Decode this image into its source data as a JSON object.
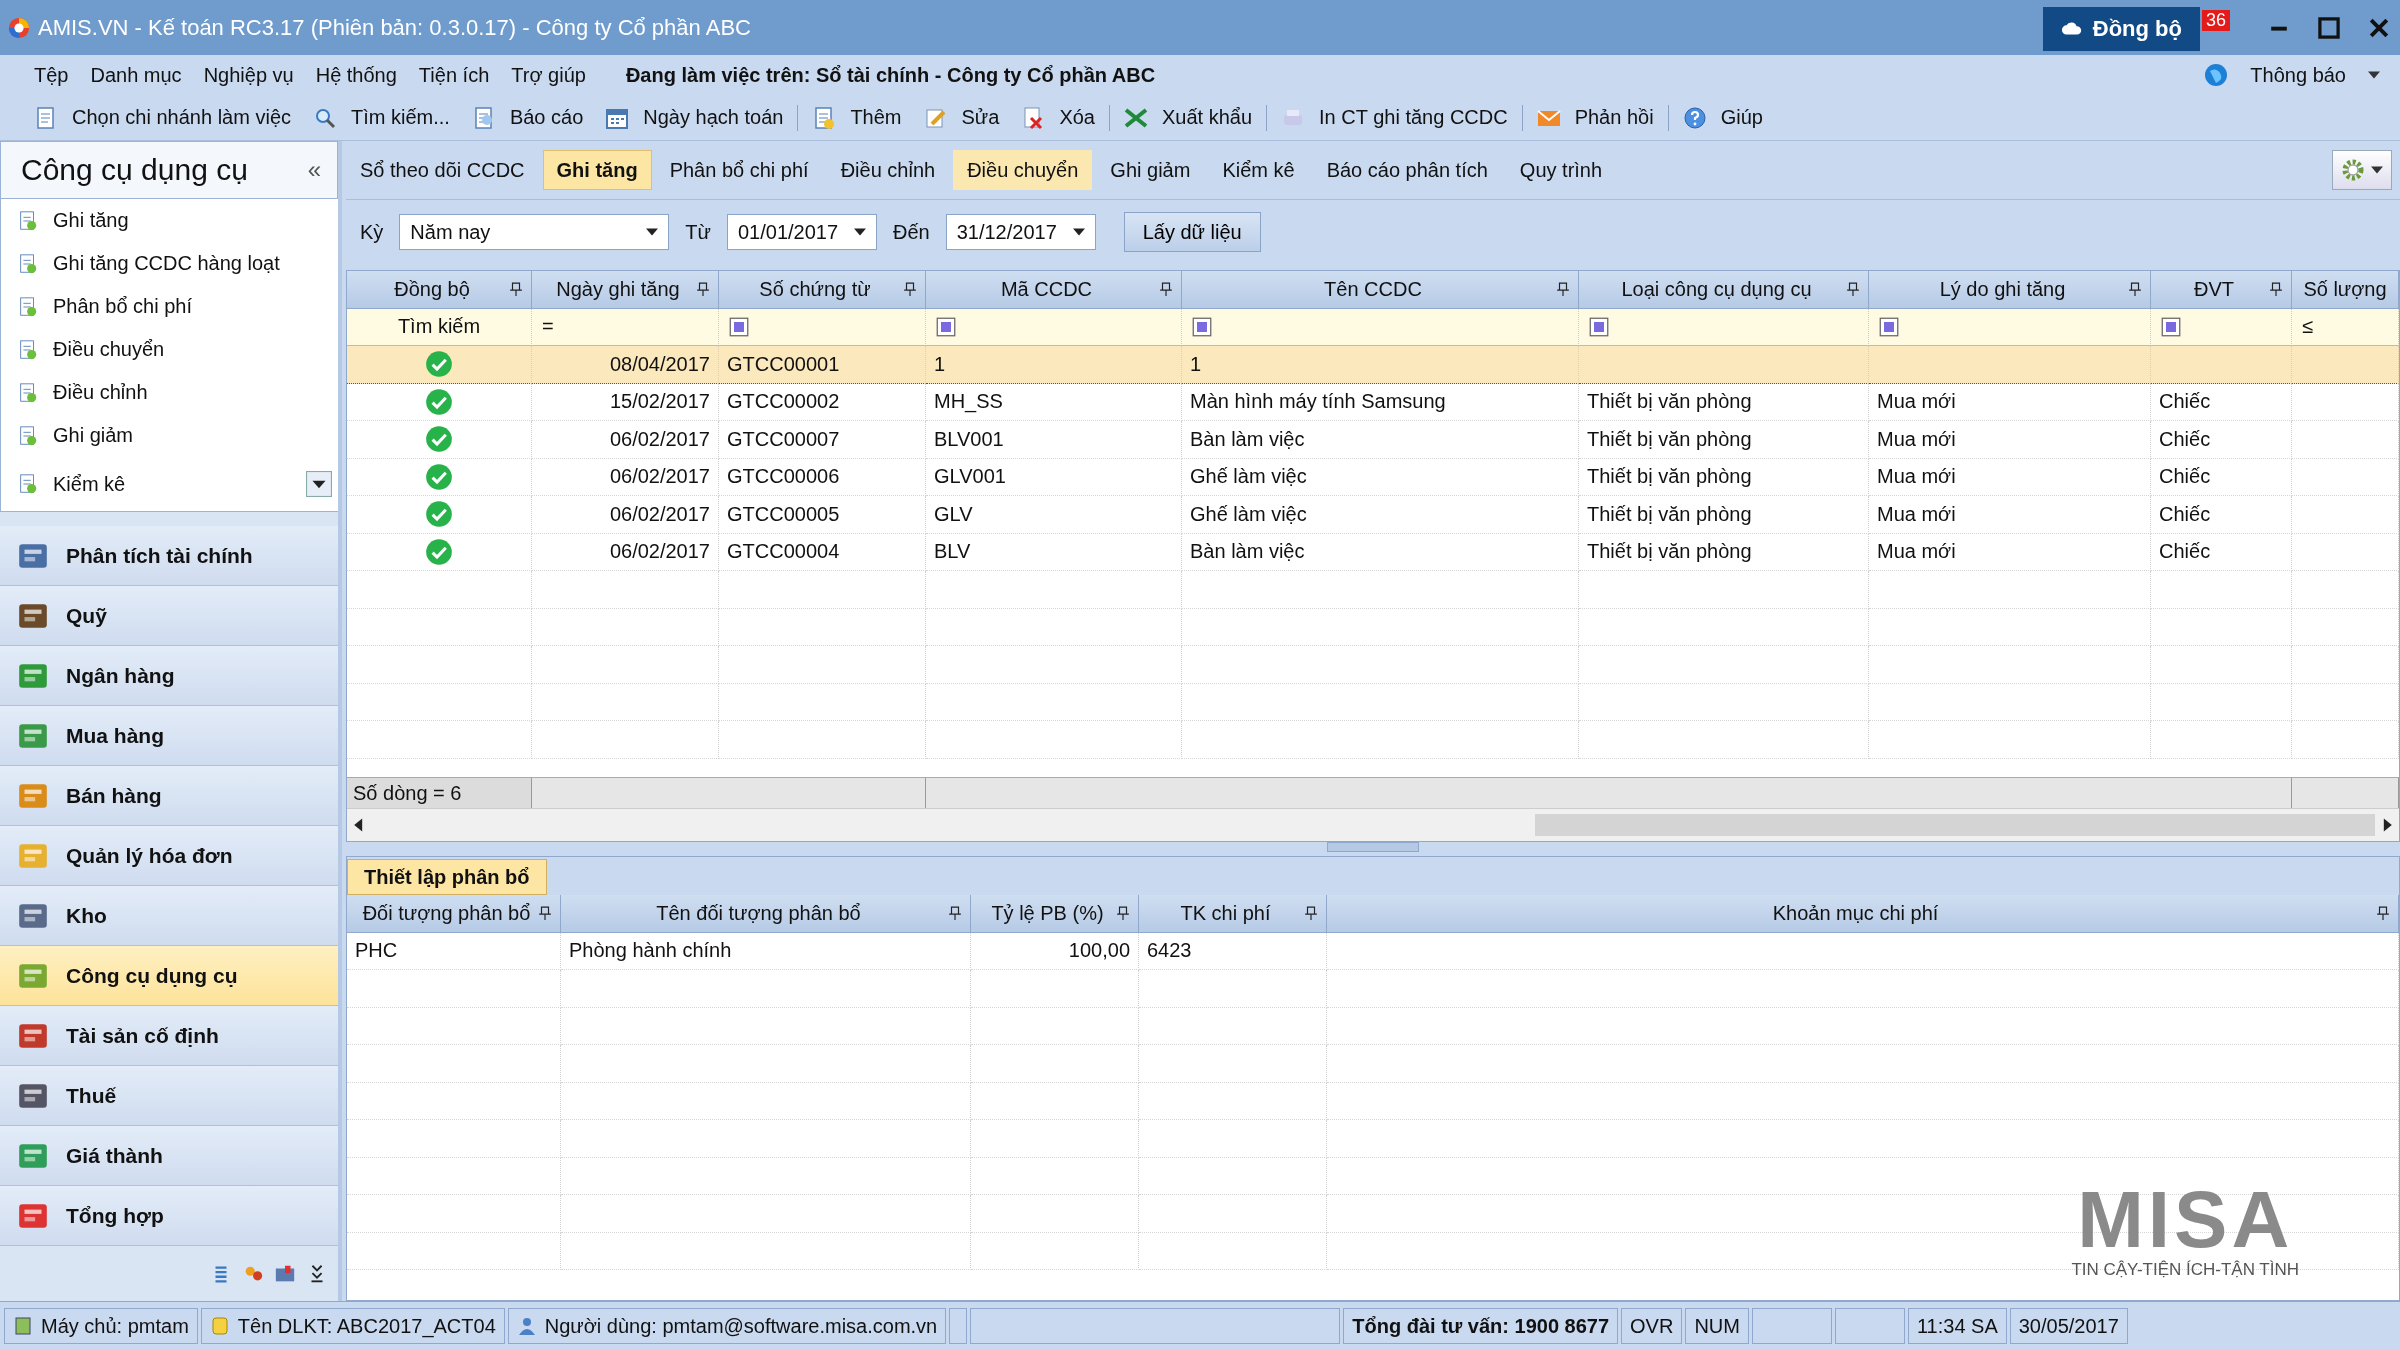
{
  "window": {
    "title": "AMIS.VN - Kế toán RC3.17 (Phiên bản: 0.3.0.17) - Công ty Cổ phần ABC",
    "sync_button": "Đồng bộ",
    "sync_badge": "36"
  },
  "menu": [
    "Tệp",
    "Danh mục",
    "Nghiệp vụ",
    "Hệ thống",
    "Tiện ích",
    "Trợ giúp"
  ],
  "working_on": "Đang làm việc trên: Sổ tài chính - Công ty Cổ phần ABC",
  "notifications": "Thông báo",
  "toolbar": [
    "Chọn chi nhánh làm việc",
    "Tìm kiếm...",
    "Báo cáo",
    "Ngày hạch toán",
    "Thêm",
    "Sửa",
    "Xóa",
    "Xuất khẩu",
    "In CT ghi tăng CCDC",
    "Phản hồi",
    "Giúp"
  ],
  "sidebar": {
    "title": "Công cụ dụng cụ",
    "collapse": "«",
    "items": [
      "Ghi tăng",
      "Ghi tăng CCDC hàng loạt",
      "Phân bổ chi phí",
      "Điều chuyển",
      "Điều chỉnh",
      "Ghi giảm",
      "Kiểm kê"
    ],
    "modules": [
      {
        "label": "Phân tích tài chính",
        "selected": false
      },
      {
        "label": "Quỹ",
        "selected": false
      },
      {
        "label": "Ngân hàng",
        "selected": false
      },
      {
        "label": "Mua hàng",
        "selected": false
      },
      {
        "label": "Bán hàng",
        "selected": false
      },
      {
        "label": "Quản lý hóa đơn",
        "selected": false
      },
      {
        "label": "Kho",
        "selected": false
      },
      {
        "label": "Công cụ dụng cụ",
        "selected": true
      },
      {
        "label": "Tài sản cố định",
        "selected": false
      },
      {
        "label": "Thuế",
        "selected": false
      },
      {
        "label": "Giá thành",
        "selected": false
      },
      {
        "label": "Tổng hợp",
        "selected": false
      }
    ]
  },
  "tabs": [
    {
      "label": "Sổ theo dõi CCDC",
      "selected": false,
      "highlighted": false
    },
    {
      "label": "Ghi tăng",
      "selected": true,
      "highlighted": false
    },
    {
      "label": "Phân bổ chi phí",
      "selected": false,
      "highlighted": false
    },
    {
      "label": "Điều chỉnh",
      "selected": false,
      "highlighted": false
    },
    {
      "label": "Điều chuyển",
      "selected": false,
      "highlighted": true
    },
    {
      "label": "Ghi giảm",
      "selected": false,
      "highlighted": false
    },
    {
      "label": "Kiểm kê",
      "selected": false,
      "highlighted": false
    },
    {
      "label": "Báo cáo phân tích",
      "selected": false,
      "highlighted": false
    },
    {
      "label": "Quy trình",
      "selected": false,
      "highlighted": false
    }
  ],
  "filter": {
    "period_label": "Kỳ",
    "period": "Năm nay",
    "from_label": "Từ",
    "from": "01/01/2017",
    "to_label": "Đến",
    "to": "31/12/2017",
    "button": "Lấy dữ liệu"
  },
  "table": {
    "columns": [
      "Đồng bộ",
      "Ngày ghi tăng",
      "Số chứng từ",
      "Mã CCDC",
      "Tên CCDC",
      "Loại công cụ dụng cụ",
      "Lý do ghi tăng",
      "ĐVT",
      "Số lượng"
    ],
    "filter_cells": [
      {
        "kind": "label",
        "text": "Tìm kiếm"
      },
      {
        "kind": "operator",
        "text": "="
      },
      {
        "kind": "checkbox"
      },
      {
        "kind": "checkbox"
      },
      {
        "kind": "checkbox"
      },
      {
        "kind": "checkbox"
      },
      {
        "kind": "checkbox"
      },
      {
        "kind": "checkbox"
      },
      {
        "kind": "operator",
        "text": "≤"
      }
    ],
    "rows": [
      {
        "selected": true,
        "synced": true,
        "cells": [
          "",
          "08/04/2017",
          "GTCC00001",
          "1",
          "1"
        ]
      },
      {
        "selected": false,
        "synced": true,
        "cells": [
          "",
          "15/02/2017",
          "GTCC00002",
          "MH_SS",
          "Màn hình máy tính Samsung",
          "Thiết bị văn phòng",
          "Mua mới",
          "Chiếc"
        ]
      },
      {
        "selected": false,
        "synced": true,
        "cells": [
          "",
          "06/02/2017",
          "GTCC00007",
          "BLV001",
          "Bàn làm việc",
          "Thiết bị văn phòng",
          "Mua mới",
          "Chiếc"
        ]
      },
      {
        "selected": false,
        "synced": true,
        "cells": [
          "",
          "06/02/2017",
          "GTCC00006",
          "GLV001",
          "Ghế làm việc",
          "Thiết bị văn phòng",
          "Mua mới",
          "Chiếc"
        ]
      },
      {
        "selected": false,
        "synced": true,
        "cells": [
          "",
          "06/02/2017",
          "GTCC00005",
          "GLV",
          "Ghế làm việc",
          "Thiết bị văn phòng",
          "Mua mới",
          "Chiếc"
        ]
      },
      {
        "selected": false,
        "synced": true,
        "cells": [
          "",
          "06/02/2017",
          "GTCC00004",
          "BLV",
          "Bàn làm việc",
          "Thiết bị văn phòng",
          "Mua mới",
          "Chiếc"
        ]
      }
    ],
    "row_count": "Số dòng = 6"
  },
  "allocation": {
    "tab": "Thiết lập phân bổ",
    "columns": [
      "Đối tượng phân bổ",
      "Tên đối tượng phân bổ",
      "Tỷ lệ PB (%)",
      "TK chi phí",
      "Khoản mục chi phí"
    ],
    "rows": [
      [
        "PHC",
        "Phòng hành chính",
        "100,00",
        "6423"
      ]
    ]
  },
  "logo": {
    "name": "MISA",
    "tagline": "TIN CẬY-TIỆN ÍCH-TẬN TÌNH"
  },
  "status_bar": [
    {
      "kind": "server",
      "text": "Máy chủ: pmtam"
    },
    {
      "kind": "database",
      "text": "Tên DLKT: ABC2017_ACT04"
    },
    {
      "kind": "user",
      "text": "Người dùng: pmtam@software.misa.com.vn"
    },
    {
      "kind": "hotline",
      "text": "Tổng đài tư vấn: 1900 8677"
    },
    {
      "kind": "plain",
      "text": "OVR"
    },
    {
      "kind": "plain",
      "text": "NUM"
    },
    {
      "kind": "time",
      "text": "11:34 SA"
    },
    {
      "kind": "plain",
      "text": "30/05/2017"
    }
  ]
}
